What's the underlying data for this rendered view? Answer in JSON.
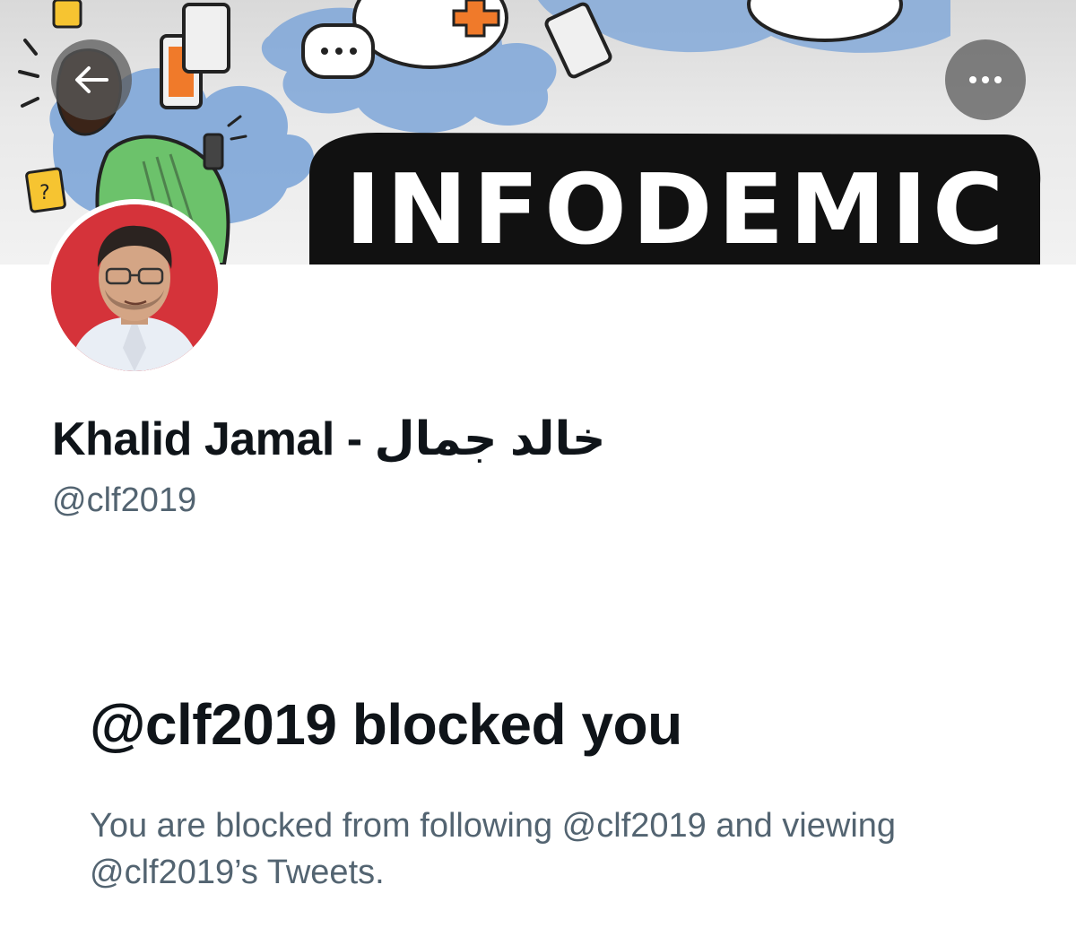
{
  "banner": {
    "word": "INFODEMIC"
  },
  "header": {
    "back_icon": "arrow-left-icon",
    "more_icon": "more-horizontal-icon"
  },
  "profile": {
    "display_name": "Khalid Jamal - خالد جمال",
    "handle": "@clf2019"
  },
  "blocked": {
    "title": "@clf2019 blocked you",
    "description": "You are blocked from following @clf2019 and viewing @clf2019’s Tweets."
  },
  "colors": {
    "primary_text": "#0f1419",
    "secondary_text": "#536471",
    "button_overlay": "#5a5a5a",
    "avatar_background": "#d5333a"
  }
}
